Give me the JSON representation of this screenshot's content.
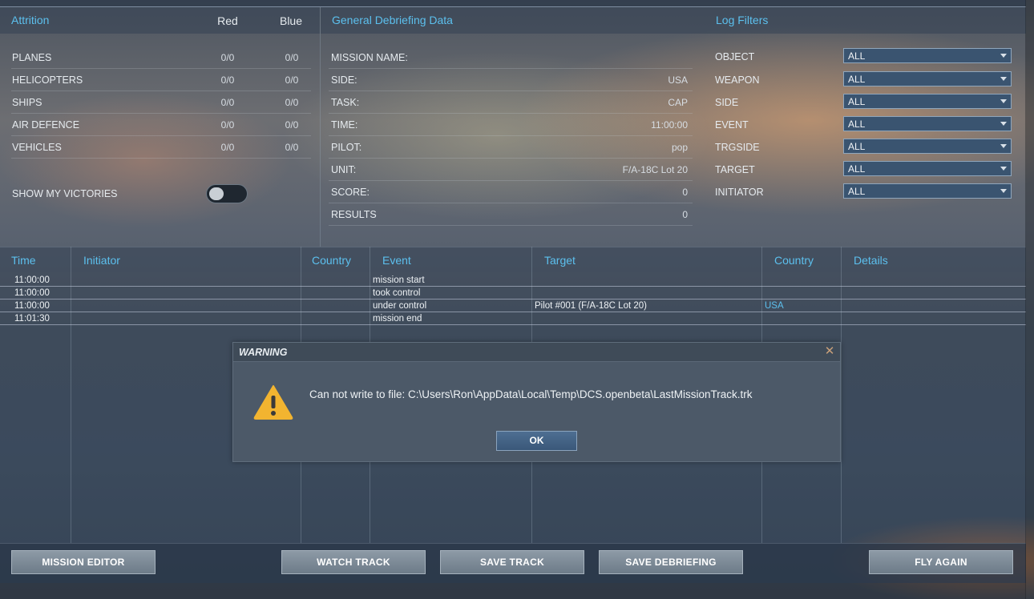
{
  "attrition": {
    "title": "Attrition",
    "col_red": "Red",
    "col_blue": "Blue",
    "rows": [
      {
        "label": "PLANES",
        "red": "0/0",
        "blue": "0/0"
      },
      {
        "label": "HELICOPTERS",
        "red": "0/0",
        "blue": "0/0"
      },
      {
        "label": "SHIPS",
        "red": "0/0",
        "blue": "0/0"
      },
      {
        "label": "AIR DEFENCE",
        "red": "0/0",
        "blue": "0/0"
      },
      {
        "label": "VEHICLES",
        "red": "0/0",
        "blue": "0/0"
      }
    ],
    "show_victories_label": "SHOW MY VICTORIES",
    "show_victories_on": false
  },
  "general": {
    "title": "General Debriefing Data",
    "rows": [
      {
        "label": "MISSION NAME:",
        "value": ""
      },
      {
        "label": "SIDE:",
        "value": "USA"
      },
      {
        "label": "TASK:",
        "value": "CAP"
      },
      {
        "label": "TIME:",
        "value": "11:00:00"
      },
      {
        "label": "PILOT:",
        "value": "pop"
      },
      {
        "label": "UNIT:",
        "value": "F/A-18C Lot 20"
      },
      {
        "label": "SCORE:",
        "value": "0"
      },
      {
        "label": "RESULTS",
        "value": "0"
      }
    ]
  },
  "filters": {
    "title": "Log Filters",
    "rows": [
      {
        "label": "OBJECT",
        "value": "ALL"
      },
      {
        "label": "WEAPON",
        "value": "ALL"
      },
      {
        "label": "SIDE",
        "value": "ALL"
      },
      {
        "label": "EVENT",
        "value": "ALL"
      },
      {
        "label": "TRGSIDE",
        "value": "ALL"
      },
      {
        "label": "TARGET",
        "value": "ALL"
      },
      {
        "label": "INITIATOR",
        "value": "ALL"
      }
    ]
  },
  "log": {
    "headers": {
      "time": "Time",
      "initiator": "Initiator",
      "country": "Country",
      "event": "Event",
      "target": "Target",
      "country2": "Country",
      "details": "Details"
    },
    "rows": [
      {
        "time": "11:00:00",
        "initiator": "",
        "country": "",
        "event": "mission start",
        "target": "",
        "country2": "",
        "details": ""
      },
      {
        "time": "11:00:00",
        "initiator": "",
        "country": "",
        "event": "took control",
        "target": "",
        "country2": "",
        "details": ""
      },
      {
        "time": "11:00:00",
        "initiator": "",
        "country": "",
        "event": "under control",
        "target": "Pilot #001 (F/A-18C Lot 20)",
        "country2": "USA",
        "details": ""
      },
      {
        "time": "11:01:30",
        "initiator": "",
        "country": "",
        "event": "mission end",
        "target": "",
        "country2": "",
        "details": ""
      }
    ]
  },
  "buttons": {
    "mission_editor": "MISSION EDITOR",
    "watch_track": "WATCH TRACK",
    "save_track": "SAVE TRACK",
    "save_debriefing": "SAVE DEBRIEFING",
    "fly_again": "FLY AGAIN"
  },
  "dialog": {
    "title": "WARNING",
    "close_glyph": "✕",
    "icon": "warning-triangle-icon",
    "message": "Can not write to file: C:\\Users\\Ron\\AppData\\Local\\Temp\\DCS.openbeta\\LastMissionTrack.trk",
    "ok_label": "OK"
  },
  "colors": {
    "header_accent": "#5cc0ee",
    "warning_yellow": "#f2b430"
  }
}
